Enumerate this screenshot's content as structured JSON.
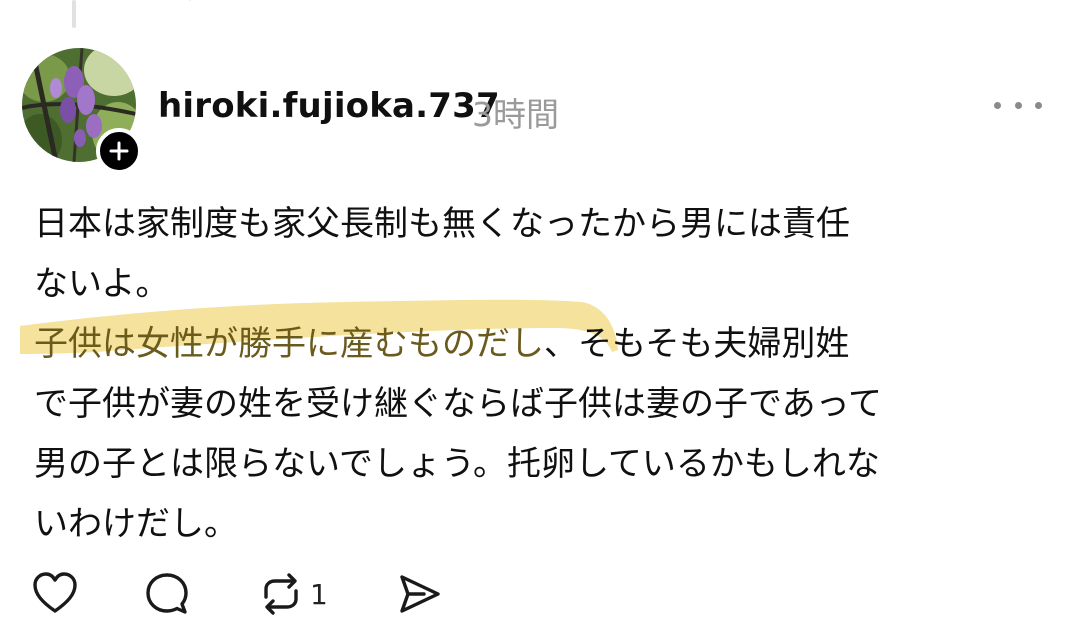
{
  "post": {
    "username": "hiroki.fujioka.737",
    "timestamp": "3時間",
    "lines": [
      {
        "plain": "日本は家制度も家父長制も無くなったから男には責任"
      },
      {
        "plain": "ないよ。"
      },
      {
        "highlight": "子供は女性が勝手に産むものだし",
        "plain": "、そもそも夫婦別姓"
      },
      {
        "plain": "で子供が妻の姓を受け継ぐならば子供は妻の子であって"
      },
      {
        "plain": "男の子とは限らないでしょう。托卵しているかもしれな"
      },
      {
        "plain": "いわけだし。"
      }
    ],
    "actions": {
      "like_icon": "heart-icon",
      "reply_icon": "comment-icon",
      "repost_icon": "repost-icon",
      "repost_count": "1",
      "share_icon": "send-icon"
    }
  },
  "colors": {
    "highlight": "#f3dd8c",
    "highlight_text": "#6a5a1c",
    "timestamp": "#9a9a9a",
    "text": "#101010"
  }
}
